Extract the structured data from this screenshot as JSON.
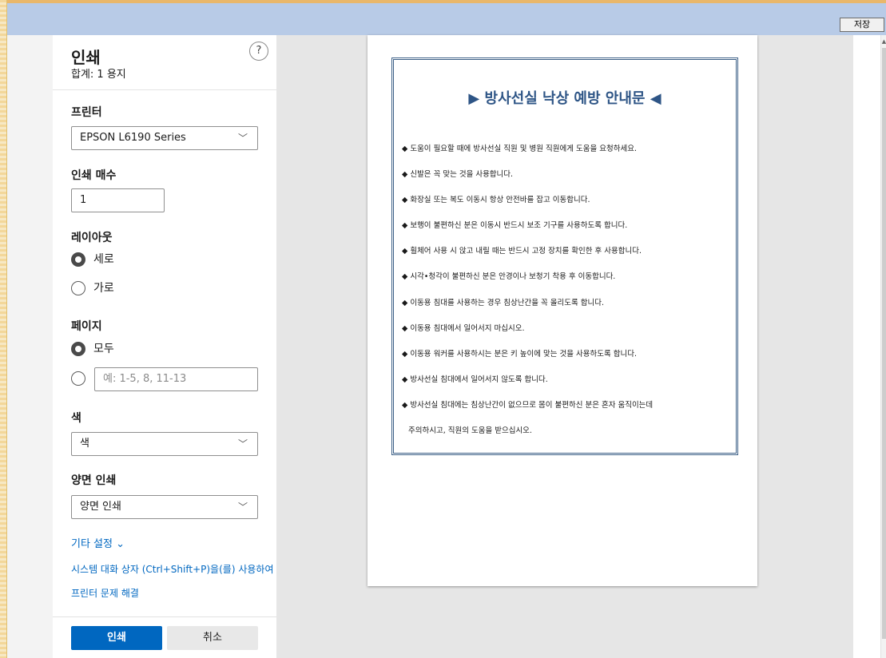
{
  "toolbar": {
    "save_label": "저장"
  },
  "dialog": {
    "title": "인쇄",
    "summary": "합계: 1 용지",
    "help": "?",
    "printer": {
      "label": "프린터",
      "value": "EPSON L6190 Series"
    },
    "copies": {
      "label": "인쇄 매수",
      "value": "1"
    },
    "layout": {
      "label": "레이아웃",
      "options": [
        "세로",
        "가로"
      ],
      "selected": "세로"
    },
    "pages": {
      "label": "페이지",
      "all_label": "모두",
      "range_placeholder": "예: 1-5, 8, 11-13",
      "selected": "모두"
    },
    "color": {
      "label": "색",
      "value": "색"
    },
    "duplex": {
      "label": "양면 인쇄",
      "value": "양면 인쇄"
    },
    "more_settings": "기타 설정 ⌄",
    "system_dialog_link": "시스템 대화 상자 (Ctrl+Shift+P)을(를) 사용하여 인쇄",
    "troubleshoot_link": "프린터 문제 해결",
    "print_button": "인쇄",
    "cancel_button": "취소"
  },
  "document": {
    "title": "▶ 방사선실 낙상 예방 안내문 ◀",
    "lines": [
      "◆ 도움이 필요할 때에 방사선실 직원 및 병원 직원에게 도움을 요청하세요.",
      "◆ 신발은 꼭 맞는 것을 사용합니다.",
      "◆ 화장실 또는 복도 이동시 항상 안전바를 잡고 이동합니다.",
      "◆ 보행이 불편하신 분은 이동시 반드시 보조 기구를 사용하도록 합니다.",
      "◆ 휠체어 사용 시 앉고 내릴 때는 반드시 고정 장치를 확인한 후 사용합니다.",
      "◆ 시각•청각이 불편하신 분은 안경이나 보청기 착용 후 이동합니다.",
      "◆ 이동용 침대를 사용하는 경우 침상난간을 꼭 올리도록 합니다.",
      "◆ 이동용 침대에서 일어서지 마십시오.",
      "◆ 이동용 워커를 사용하시는 분은 키 높이에 맞는 것을 사용하도록 합니다.",
      "◆ 방사선실 침대에서 일어서지 않도록 합니다.",
      "◆ 방사선실 침대에는 침상난간이 없으므로 몸이 불편하신 분은 혼자 움직이는데",
      "주의하시고, 직원의 도움을 받으십시오."
    ]
  }
}
